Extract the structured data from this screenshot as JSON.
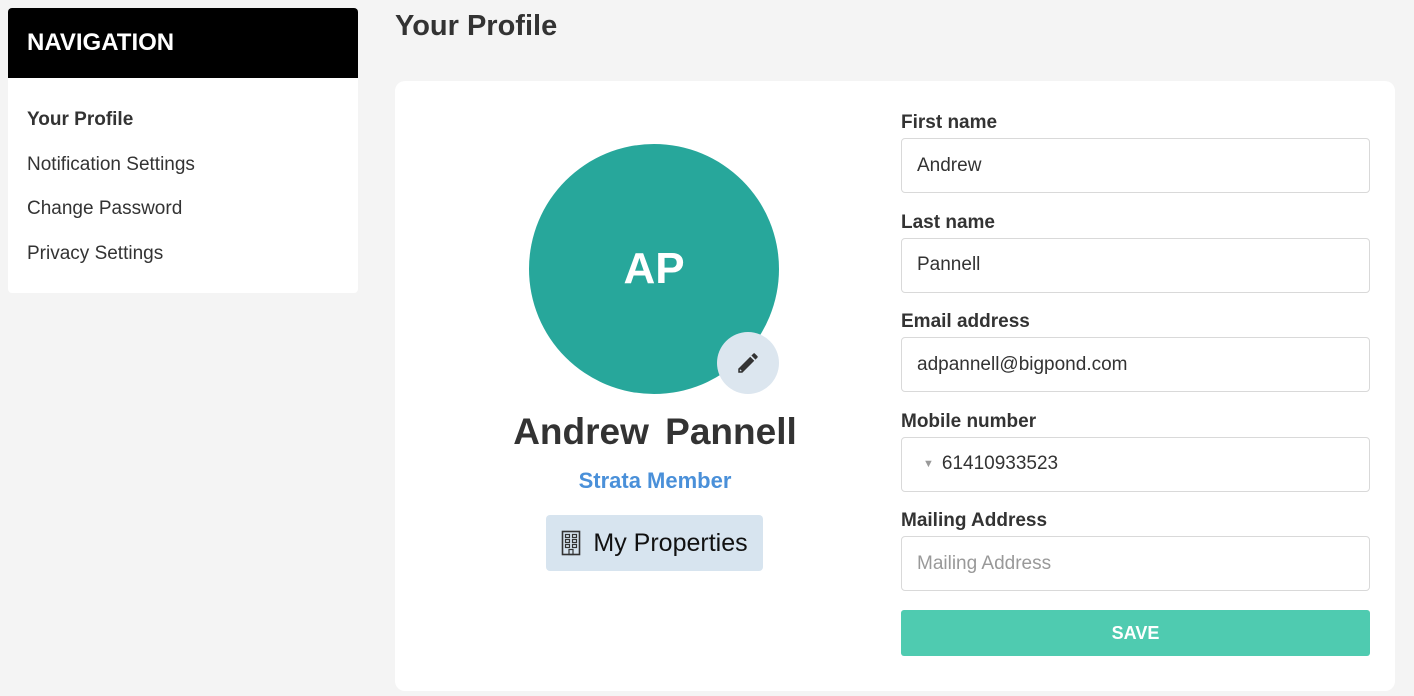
{
  "sidebar": {
    "title": "NAVIGATION",
    "items": [
      {
        "label": "Your Profile",
        "active": true
      },
      {
        "label": "Notification Settings",
        "active": false
      },
      {
        "label": "Change Password",
        "active": false
      },
      {
        "label": "Privacy Settings",
        "active": false
      }
    ]
  },
  "page": {
    "title": "Your Profile"
  },
  "profile": {
    "initials": "AP",
    "first_name": "Andrew",
    "last_name": "Pannell",
    "role": "Strata Member",
    "avatar_color": "#27a79b",
    "edit_icon": "pencil-icon",
    "properties_button_label": "My Properties",
    "properties_icon": "building-icon"
  },
  "form": {
    "first_name": {
      "label": "First name",
      "value": "Andrew"
    },
    "last_name": {
      "label": "Last name",
      "value": "Pannell"
    },
    "email": {
      "label": "Email address",
      "value": "adpannell@bigpond.com"
    },
    "mobile": {
      "label": "Mobile number",
      "value": "61410933523",
      "country_icon": "▼"
    },
    "mailing_address": {
      "label": "Mailing Address",
      "value": "",
      "placeholder": "Mailing Address"
    },
    "save_label": "SAVE",
    "save_color": "#4fcbb0"
  }
}
